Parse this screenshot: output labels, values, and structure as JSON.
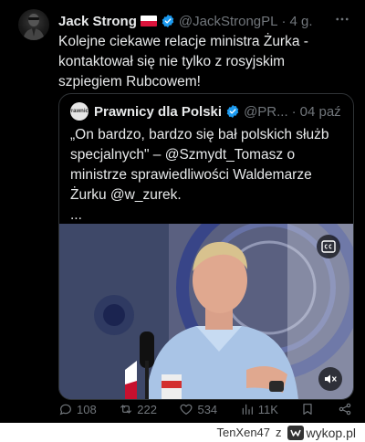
{
  "tweet": {
    "author_name": "Jack Strong",
    "handle": "@JackStrongPL",
    "time": "4 g.",
    "text": "Kolejne ciekawe relacje ministra Żurka - kontaktował się nie tylko z rosyjskim szpiegiem Rubcowem!"
  },
  "quote": {
    "author_name": "Prawnicy dla Polski",
    "handle": "@PR...",
    "time": "04 paź",
    "avatar_text": "Prawnicy",
    "text_lines": [
      "„On bardzo, bardzo się bał polskich służb",
      "specjalnych\" – @Szmydt_Tomasz o",
      "ministrze sprawiedliwości Waldemarze",
      "Żurku @w_zurek.",
      "..."
    ]
  },
  "actions": {
    "replies": "108",
    "reposts": "222",
    "likes": "534",
    "views": "11K"
  },
  "footer": {
    "user": "TenXen47",
    "sep": "z",
    "site": "wykop.pl"
  },
  "icons": [
    "more-icon",
    "verified-icon",
    "cc-icon",
    "mute-icon",
    "reply-icon",
    "repost-icon",
    "like-icon",
    "views-icon",
    "bookmark-icon",
    "share-icon",
    "wykop-logo-icon"
  ],
  "colors": {
    "background": "#000000",
    "text": "#e7e9ea",
    "muted": "#71767b",
    "verified": "#1d9bf0",
    "border": "#2f3336"
  }
}
